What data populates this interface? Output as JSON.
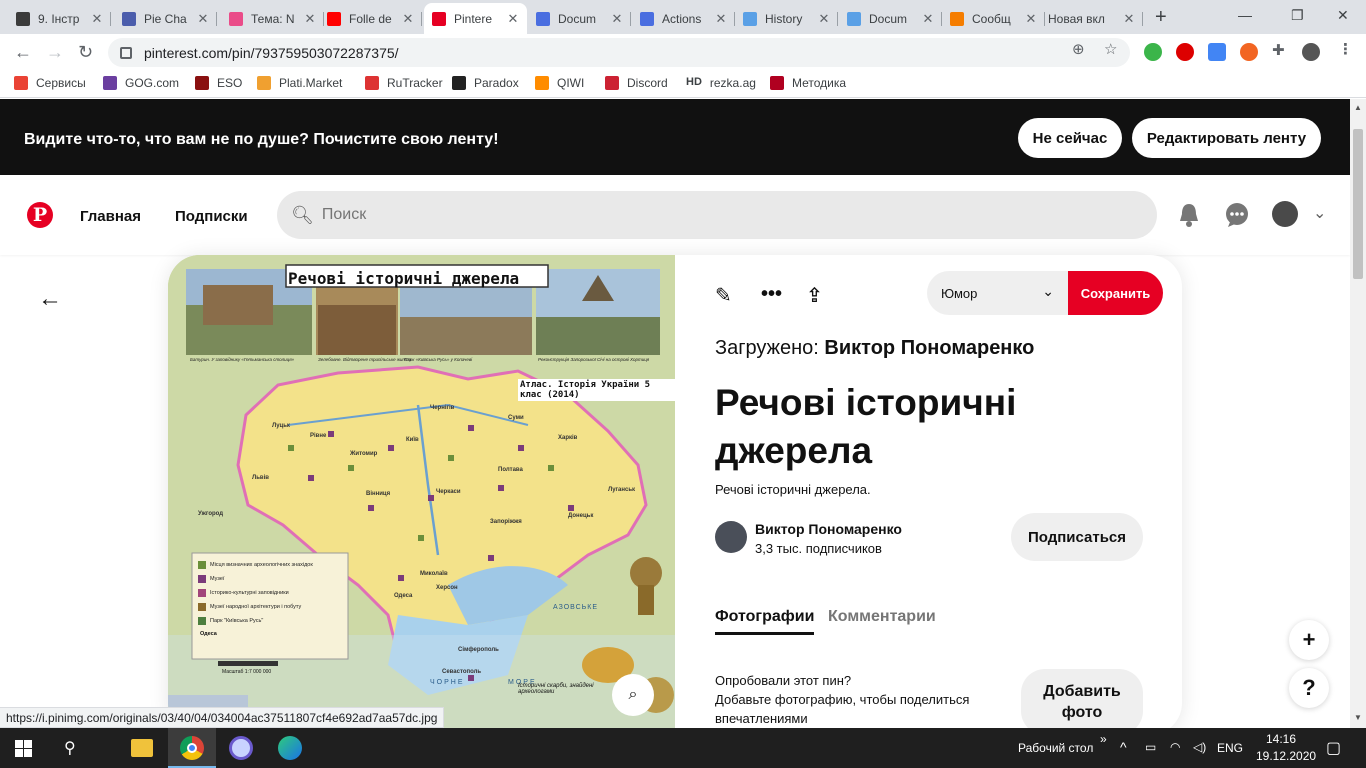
{
  "browser": {
    "tabs": [
      {
        "title": "9. Інстр",
        "icon": "doc-icon",
        "color": "#3b3b3b"
      },
      {
        "title": "Pie Cha",
        "icon": "chart-icon",
        "color": "#4b5dac"
      },
      {
        "title": "Тема: N",
        "icon": "dribbble-icon",
        "color": "#ea4c89"
      },
      {
        "title": "Folle de",
        "icon": "youtube-icon",
        "color": "#ff0000"
      },
      {
        "title": "Pintere",
        "icon": "pinterest-icon",
        "color": "#e60023",
        "active": true
      },
      {
        "title": "Docum",
        "icon": "star-icon",
        "color": "#4a6ee0"
      },
      {
        "title": "Actions",
        "icon": "star-icon",
        "color": "#4a6ee0"
      },
      {
        "title": "History",
        "icon": "page-icon",
        "color": "#5aa0e6"
      },
      {
        "title": "Docum",
        "icon": "page-icon",
        "color": "#5aa0e6"
      },
      {
        "title": "Сообщ",
        "icon": "blogger-icon",
        "color": "#f57d00"
      },
      {
        "title": "Новая вкл",
        "icon": "",
        "color": "#dee1e6"
      }
    ],
    "url": "pinterest.com/pin/793759503072287375/",
    "bookmarks": [
      {
        "label": "Сервисы",
        "color": "#ea4335"
      },
      {
        "label": "GOG.com",
        "color": "#6b3fa0"
      },
      {
        "label": "ESO",
        "color": "#8a1010"
      },
      {
        "label": "Plati.Market",
        "color": "#f0a030"
      },
      {
        "label": "RuTracker",
        "color": "#d33"
      },
      {
        "label": "Paradox",
        "color": "#222"
      },
      {
        "label": "QIWI",
        "color": "#ff8c00"
      },
      {
        "label": "Discord",
        "color": "#c23"
      },
      {
        "label": "rezka.ag",
        "color": "#111",
        "prefix": "HD"
      },
      {
        "label": "Методика",
        "color": "#b00020"
      }
    ],
    "status_url": "https://i.pinimg.com/originals/03/40/04/034004ac37511807cf4e692ad7aa57dc.jpg"
  },
  "banner": {
    "message": "Видите что-то, что вам не по душе? Почистите свою ленту!",
    "not_now": "Не сейчас",
    "edit_feed": "Редактировать ленту"
  },
  "header": {
    "logo": "P",
    "home": "Главная",
    "following": "Подписки",
    "search_placeholder": "Поиск"
  },
  "pin": {
    "board": "Юмор",
    "save": "Сохранить",
    "uploaded_prefix": "Загружено:",
    "uploader": "Виктор Пономаренко",
    "title": "Речові історичні джерела",
    "description": "Речові історичні джерела.",
    "author_name": "Виктор Пономаренко",
    "author_followers": "3,3 тыс. подписчиков",
    "follow": "Подписаться",
    "tab_photos": "Фотографии",
    "tab_comments": "Комментарии",
    "try_line1": "Опробовали этот пин?",
    "try_line2": "Добавьте фотографию, чтобы поделиться",
    "try_line3": "впечатлениями",
    "add_photo": "Добавить фото",
    "image": {
      "heading": "Речові історичні джерела",
      "atlas_caption": "Атлас. Історія України 5 клас (2014)",
      "sea_azov": "АЗОВСЬКЕ",
      "sea_black_1": "ЧОРНЕ",
      "sea_black_2": "МОРЕ",
      "legend": [
        "Місця визначних археологічних знахідок",
        "Музеї",
        "Історико-культурні заповідники",
        "Музеї народної архітектури і побуту",
        "Парк \"Київська Русь\""
      ],
      "legend_city": "Одеса",
      "scale": "Масштаб 1:7 000 000",
      "bottom_caption": "Історичні скарби, знайдені археологами",
      "photo_captions": [
        "Батурин. У заповіднику «Гетьманська столиця»",
        "Зелебовне. Відтворене трипільське житло",
        "Парк «Київська Русь» у Копачеві",
        "Реконструкція Запорозької Січі на острові Хортиця"
      ],
      "cities": [
        "Київ",
        "Чернігів",
        "Житомир",
        "Рівне",
        "Луцьк",
        "Львів",
        "Ужгород",
        "Полтава",
        "Харків",
        "Суми",
        "Одеса",
        "Херсон",
        "Миколаїв",
        "Запоріжжя",
        "Донецьк",
        "Луганськ",
        "Сімферополь",
        "Севастополь",
        "Черкаси",
        "Вінниця"
      ]
    }
  },
  "floating": {
    "plus": "+",
    "help": "?"
  },
  "taskbar": {
    "desktop": "Рабочий стол",
    "lang": "ENG",
    "time": "14:16",
    "date": "19.12.2020"
  }
}
